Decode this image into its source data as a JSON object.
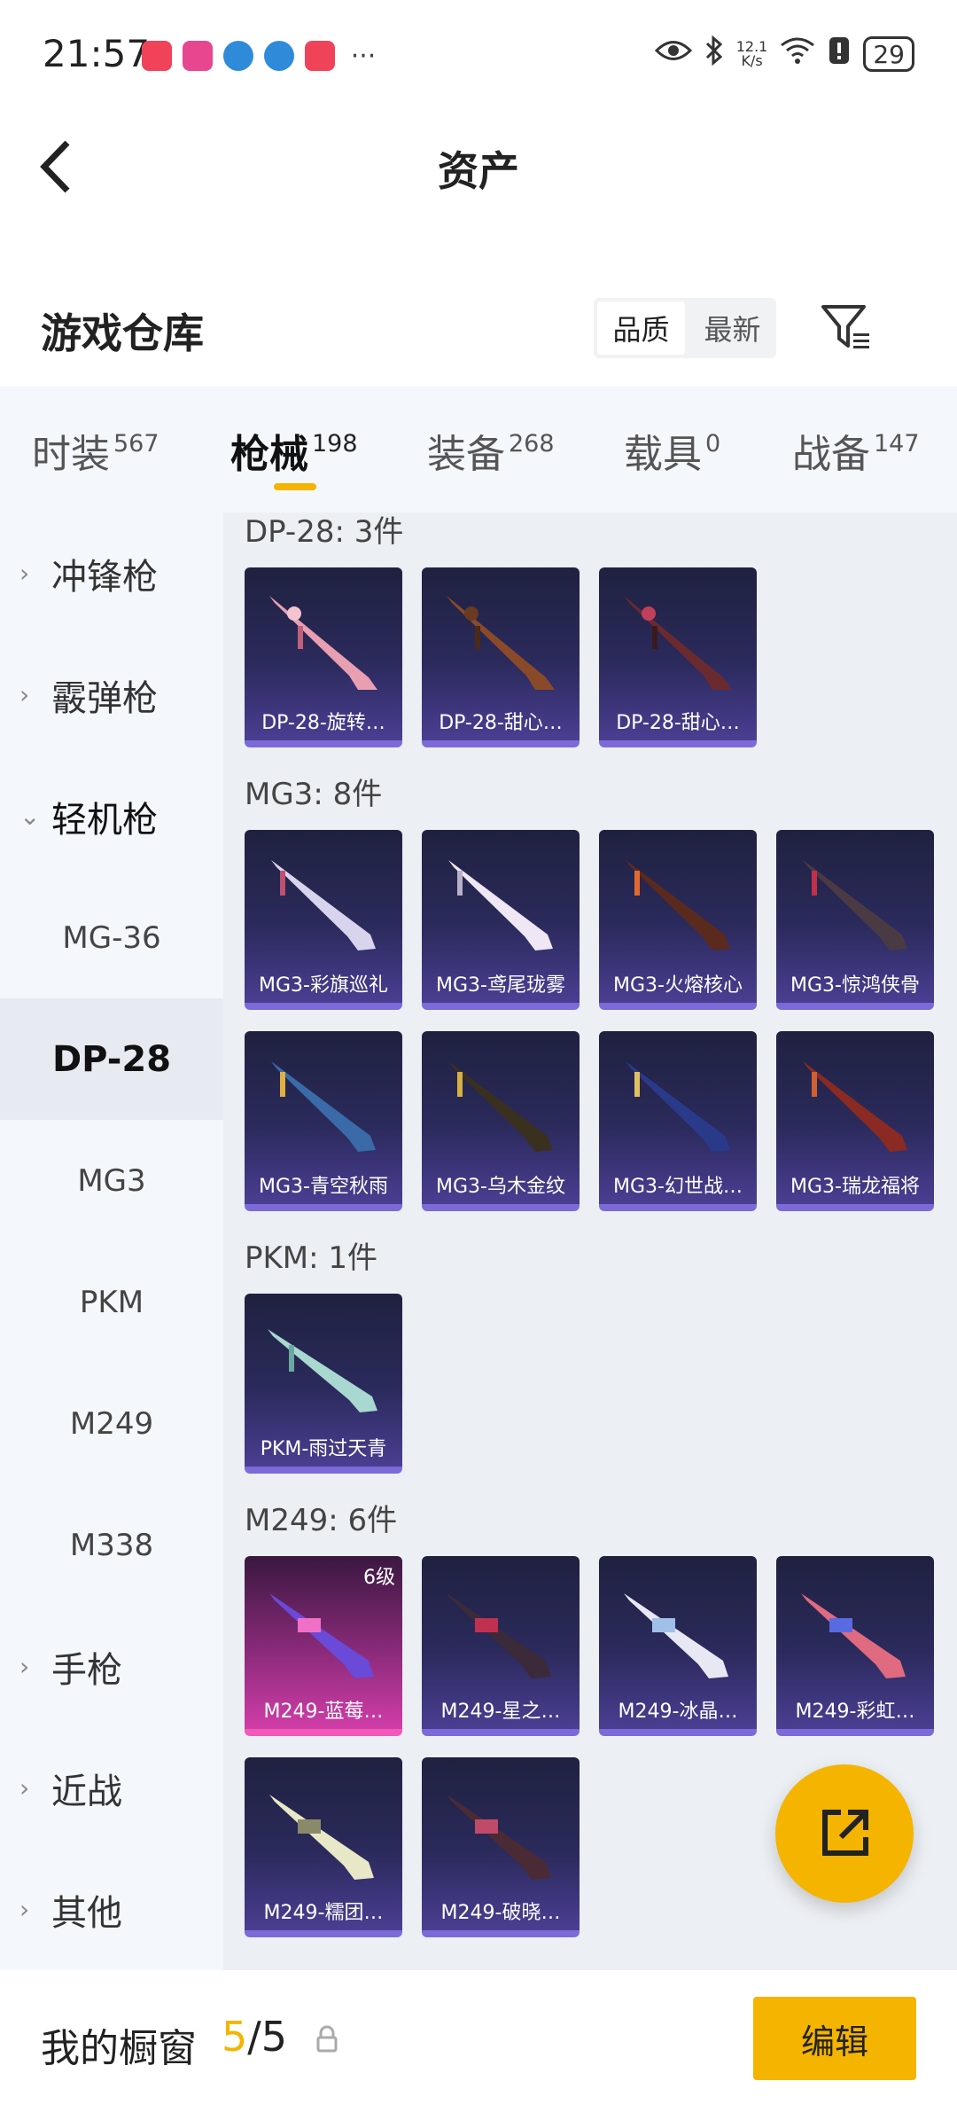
{
  "status_bar": {
    "time": "21:57",
    "notification_icons": [
      "shop-icon",
      "lola-app-icon",
      "browser-icon",
      "browser-icon",
      "shop-icon"
    ],
    "more": "···",
    "net_speed": "12.1\nK/s",
    "battery": "29"
  },
  "header": {
    "title": "资产"
  },
  "warehouse": {
    "title": "游戏仓库",
    "sort_options": [
      "品质",
      "最新"
    ],
    "active_sort": "品质"
  },
  "tabs": [
    {
      "label": "时装",
      "count": "567"
    },
    {
      "label": "枪械",
      "count": "198",
      "active": true
    },
    {
      "label": "装备",
      "count": "268"
    },
    {
      "label": "载具",
      "count": "0"
    },
    {
      "label": "战备",
      "count": "147"
    }
  ],
  "sidebar": {
    "categories": [
      {
        "label": "冲锋枪",
        "open": false
      },
      {
        "label": "霰弹枪",
        "open": false
      },
      {
        "label": "轻机枪",
        "open": true
      },
      {
        "label": "MG-36"
      },
      {
        "label": "DP-28",
        "selected": true
      },
      {
        "label": "MG3"
      },
      {
        "label": "PKM"
      },
      {
        "label": "M249"
      },
      {
        "label": "M338"
      },
      {
        "label": "手枪",
        "open": false
      },
      {
        "label": "近战",
        "open": false
      },
      {
        "label": "其他",
        "open": false
      }
    ]
  },
  "groups": [
    {
      "title": "DP-28: 3件",
      "items": [
        "DP-28-旋转…",
        "DP-28-甜心…",
        "DP-28-甜心…"
      ]
    },
    {
      "title": "MG3: 8件",
      "items": [
        "MG3-彩旗巡礼",
        "MG3-鸢尾珑雾",
        "MG3-火熔核心",
        "MG3-惊鸿侠骨",
        "MG3-青空秋雨",
        "MG3-乌木金纹",
        "MG3-幻世战…",
        "MG3-瑞龙福将"
      ]
    },
    {
      "title": "PKM: 1件",
      "items": [
        "PKM-雨过天青"
      ]
    },
    {
      "title": "M249: 6件",
      "items": [
        "M249-蓝莓…",
        "M249-星之…",
        "M249-冰晶…",
        "M249-彩虹…",
        "M249-糯团…",
        "M249-破晓…"
      ],
      "first_level": "6级"
    }
  ],
  "bottom_bar": {
    "title": "我的橱窗",
    "current": "5",
    "total": "/5",
    "edit_label": "编辑"
  },
  "colors": {
    "accent": "#f5b400",
    "card_purple": "#4a3e92",
    "card_pink": "#d13da8"
  }
}
